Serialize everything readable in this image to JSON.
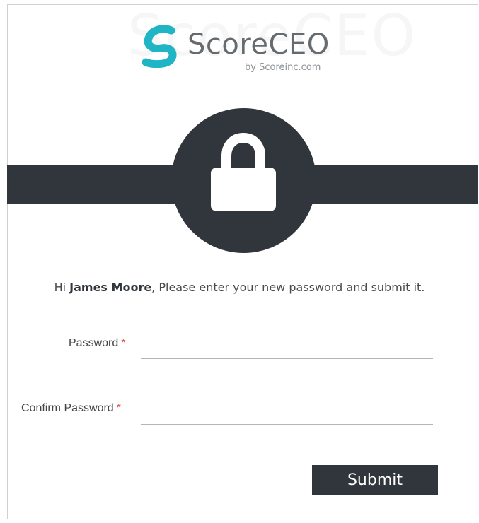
{
  "brand": {
    "name": "ScoreCEO",
    "tagline": "by Scoreinc.com",
    "color": "#1fb5c4"
  },
  "hero": {
    "icon": "lock-icon",
    "band_color": "#30363c"
  },
  "greeting": {
    "prefix": "Hi ",
    "user_name": "James Moore",
    "suffix": ", Please enter your new password and submit it."
  },
  "form": {
    "password_label": "Password",
    "password_required_marker": "*",
    "password_value": "",
    "confirm_label": "Confirm Password",
    "confirm_required_marker": "*",
    "confirm_value": "",
    "submit_label": "Submit"
  }
}
